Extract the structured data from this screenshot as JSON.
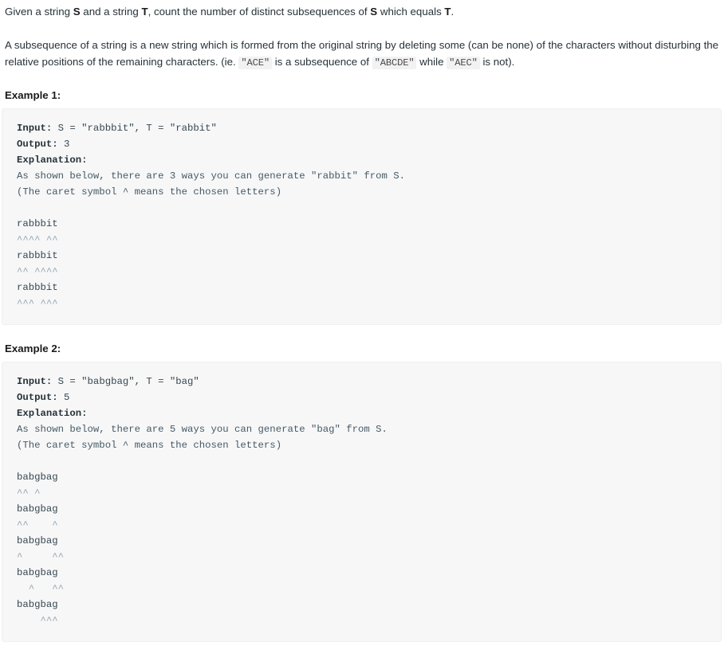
{
  "problem": {
    "intro_parts": {
      "before_s": "Given a string ",
      "s": "S",
      "mid": " and a string ",
      "t": "T",
      "after": ", count the number of distinct subsequences of ",
      "s2": "S",
      "tail": " which equals ",
      "t2": "T",
      "period": "."
    },
    "definition_parts": {
      "lead": "A subsequence of a string is a new string which is formed from the original string by deleting some (can be none) of the characters without disturbing the relative positions of the remaining characters. (ie. ",
      "code_ace": "\"ACE\"",
      "mid1": " is a subsequence of ",
      "code_abcde": "\"ABCDE\"",
      "mid2": " while ",
      "code_aec": "\"AEC\"",
      "tail": " is not)."
    }
  },
  "examples": [
    {
      "heading": "Example 1:",
      "input_label": "Input:",
      "input_value": " S = \"rabbbit\", T = \"rabbit\"",
      "output_label": "Output:",
      "output_value": " 3",
      "explanation_label": "Explanation:",
      "explanation_line1": "As shown below, there are 3 ways you can generate \"rabbit\" from S.",
      "explanation_line2": "(The caret symbol ^ means the chosen letters)",
      "diagram": [
        {
          "string": "rabbbit",
          "carets": "^^^^ ^^"
        },
        {
          "string": "rabbbit",
          "carets": "^^ ^^^^"
        },
        {
          "string": "rabbbit",
          "carets": "^^^ ^^^"
        }
      ]
    },
    {
      "heading": "Example 2:",
      "input_label": "Input:",
      "input_value": " S = \"babgbag\", T = \"bag\"",
      "output_label": "Output:",
      "output_value": " 5",
      "explanation_label": "Explanation:",
      "explanation_line1": "As shown below, there are 5 ways you can generate \"bag\" from S.",
      "explanation_line2": "(The caret symbol ^ means the chosen letters)",
      "diagram": [
        {
          "string": "babgbag",
          "carets": "^^ ^"
        },
        {
          "string": "babgbag",
          "carets": "^^    ^"
        },
        {
          "string": "babgbag",
          "carets": "^     ^^"
        },
        {
          "string": "babgbag",
          "carets": "  ^   ^^"
        },
        {
          "string": "babgbag",
          "carets": "    ^^^"
        }
      ]
    }
  ]
}
